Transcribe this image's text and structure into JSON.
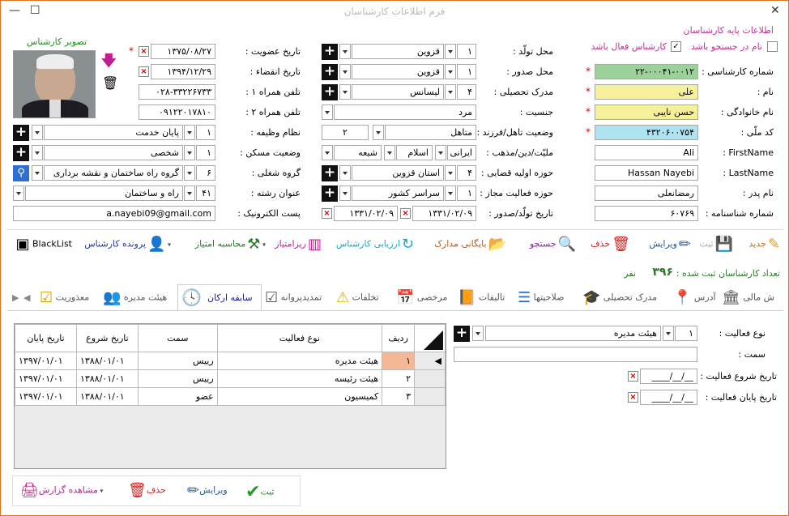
{
  "window": {
    "title": "فرم اطلاعات کارشناسان",
    "minimize": "—",
    "maximize": "☐",
    "close": "✕"
  },
  "section": {
    "title": "اطلاعات پایه کارشناسان",
    "search_checkbox": "نام در جستجو باشد",
    "active_checkbox": "کارشناس فعال باشد",
    "photo_label": "تصویر کارشناس"
  },
  "fields": {
    "expert_no_label": "شماره کارشناسی :",
    "expert_no": "۲۲-۰۰۰۴۱-۰۰۱۲",
    "name_label": "نام :",
    "name": "علی",
    "family_label": "نام خانوادگی :",
    "family": "حسن نایبی",
    "national_label": "کد ملّی :",
    "national": "۴۳۲۰۶۰۰۷۵۴",
    "first_en_label": "FirstName :",
    "first_en": "Ali",
    "last_en_label": "LastName :",
    "last_en": "Hassan  Nayebi",
    "father_label": "نام پدر :",
    "father": "رمضانعلی",
    "idno_label": "شماره شناسنامه :",
    "idno": "۶۰۷۶۹",
    "birthplace_label": "محل تولّد :",
    "birthplace_code": "۱",
    "birthplace": "قزوین",
    "issue_label": "محل صدور :",
    "issue_code": "۱",
    "issue": "قزوین",
    "degree_label": "مدرک تحصیلی :",
    "degree_code": "۴",
    "degree": "لیسانس",
    "gender_label": "جنسیت :",
    "gender": "مرد",
    "marital_label": "وضعیت تاهل/فرزند :",
    "marital": "متاهل",
    "children": "۲",
    "nation_label": "ملیّت/دین/مذهب :",
    "nation": "ایرانی",
    "religion": "اسلام",
    "sect": "شیعه",
    "judicial_label": "حوزه اولیه قضایی :",
    "judicial_code": "۴",
    "judicial": "استان قزوین",
    "area_label": "حوزه فعالیت مجاز :",
    "area_code": "۱",
    "area": "سراسر کشور",
    "birthdate_label": "تاریخ تولّد/صدور :",
    "birthdate": "۱۳۳۱/۰۲/۰۹",
    "issuedate": "۱۳۳۱/۰۲/۰۹",
    "member_label": "تاریخ عضویت :",
    "member": "۱۳۷۵/۰۸/۲۷",
    "expire_label": "تاریخ انقضاء :",
    "expire": "۱۳۹۴/۱۲/۲۹",
    "mobile1_label": "تلفن همراه ۱ :",
    "mobile1": "۰۲۸-۳۳۲۲۶۷۳۳",
    "mobile2_label": "تلفن همراه ۲ :",
    "mobile2": "۰۹۱۲۲۰۱۷۸۱۰",
    "duty_label": "نظام وظیفه :",
    "duty_code": "۱",
    "duty": "پایان خدمت",
    "house_label": "وضعیت مسکن :",
    "house_code": "۱",
    "house": "شخصی",
    "group_label": "گروه شغلی :",
    "group_code": "۶",
    "group": "گروه راه ساختمان و نقشه برداری",
    "field_label": "عنوان رشته :",
    "field_code": "۴۱",
    "field": "راه و ساختمان",
    "email_label": "پست الکترونیک :",
    "email": "a.nayebi09@gmail.com"
  },
  "toolbar": {
    "new": "جدید",
    "save": "ثبت",
    "edit": "ویرایش",
    "delete": "حذف",
    "search": "جستجو",
    "archive": "بایگانی مدارک",
    "evaluate": "ارزیابی کارشناس",
    "resume": "ریزامتیاز",
    "calc": "محاسبه امتیاز",
    "file": "پرونده کارشناس",
    "blacklist": "BlackList"
  },
  "count": {
    "label": "تعداد کارشناسان ثبت شده :",
    "value": "۳۹۶",
    "unit": "نفر"
  },
  "tabs": [
    "ش مالی",
    "آدرس",
    "مدرک تحصیلی",
    "صلاحیتها",
    "تالیفات",
    "مرخصی",
    "تخلفات",
    "تمدیدپروانه",
    "سابقه ارکان",
    "هیئت مدیره",
    "معذوریت"
  ],
  "grid": {
    "headers": {
      "row": "ردیف",
      "type": "نوع فعالیت",
      "post": "سمت",
      "start": "تاریخ شروع",
      "end": "تاریخ پایان"
    },
    "rows": [
      {
        "row": "۱",
        "type": "هیئت مدیره",
        "post": "رییس",
        "start": "۱۳۸۸/۰۱/۰۱",
        "end": "۱۳۹۷/۰۱/۰۱"
      },
      {
        "row": "۲",
        "type": "هیئت رئیسه",
        "post": "رییس",
        "start": "۱۳۸۸/۰۱/۰۱",
        "end": "۱۳۹۷/۰۱/۰۱"
      },
      {
        "row": "۳",
        "type": "کمیسیون",
        "post": "عضو",
        "start": "۱۳۸۸/۰۱/۰۱",
        "end": "۱۳۹۷/۰۱/۰۱"
      }
    ]
  },
  "detail": {
    "type_label": "نوع فعالیت :",
    "type_code": "۱",
    "type": "هیئت مدیره",
    "post_label": "سمت :",
    "start_label": "تاریخ شروع فعالیت :",
    "start": "__/__/____",
    "end_label": "تاریخ پایان فعالیت :",
    "end": "__/__/____"
  },
  "bottom": {
    "save": "ثبت",
    "edit": "ویرایش",
    "delete": "حذف",
    "report": "مشاهده گزارش"
  }
}
